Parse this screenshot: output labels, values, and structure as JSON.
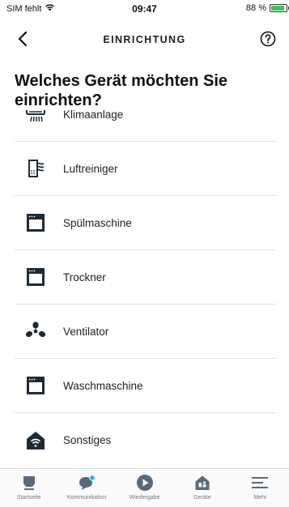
{
  "status": {
    "carrier": "SIM fehlt",
    "time": "09:47",
    "battery": "88 %",
    "battery_level": 0.88,
    "wifi_icon": "wifi-icon",
    "battery_color": "#34c759"
  },
  "nav": {
    "title": "EINRICHTUNG",
    "back_icon": "chevron-left-icon",
    "help_icon": "help-circle-icon"
  },
  "page": {
    "title": "Welches Gerät möchten Sie einrichten?"
  },
  "devices": [
    {
      "label": "Klimaanlage",
      "icon": "air-conditioner-icon"
    },
    {
      "label": "Luftreiniger",
      "icon": "air-purifier-icon"
    },
    {
      "label": "Spülmaschine",
      "icon": "dishwasher-icon"
    },
    {
      "label": "Trockner",
      "icon": "dryer-icon"
    },
    {
      "label": "Ventilator",
      "icon": "fan-icon"
    },
    {
      "label": "Waschmaschine",
      "icon": "washing-machine-icon"
    },
    {
      "label": "Sonstiges",
      "icon": "smart-home-icon"
    }
  ],
  "tabs": [
    {
      "label": "Startseite",
      "icon": "home-icon"
    },
    {
      "label": "Kommunikation",
      "icon": "chat-bubble-icon"
    },
    {
      "label": "Wiedergabe",
      "icon": "play-icon"
    },
    {
      "label": "Geräte",
      "icon": "devices-icon"
    },
    {
      "label": "Mehr",
      "icon": "menu-icon"
    }
  ],
  "colors": {
    "icon_dark": "#1f2a36",
    "tab_icon": "#5a6a7c",
    "notification_dot": "#1ab7ea"
  }
}
